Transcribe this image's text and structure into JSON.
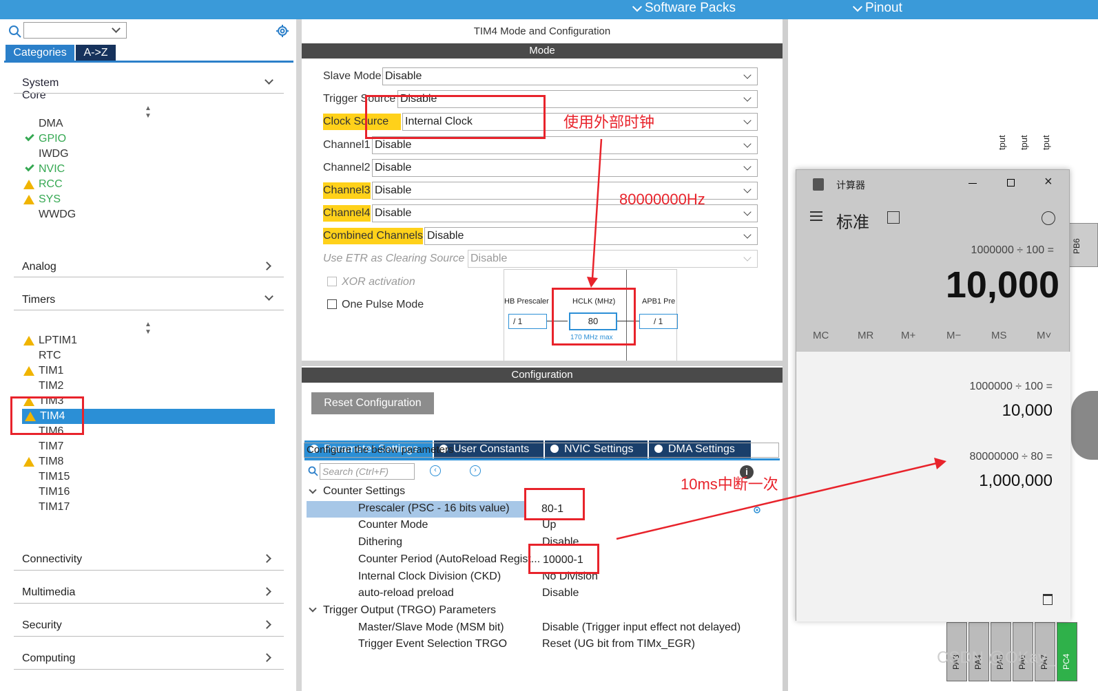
{
  "topbar": {
    "software_packs": "Software Packs",
    "pinout": "Pinout"
  },
  "left": {
    "tabs": {
      "categories": "Categories",
      "az": "A->Z"
    },
    "sections": {
      "system_core": "System Core",
      "analog": "Analog",
      "timers": "Timers",
      "connectivity": "Connectivity",
      "multimedia": "Multimedia",
      "security": "Security",
      "computing": "Computing"
    },
    "system_core_items": [
      "DMA",
      "GPIO",
      "IWDG",
      "NVIC",
      "RCC",
      "SYS",
      "WWDG"
    ],
    "timer_items": [
      "LPTIM1",
      "RTC",
      "TIM1",
      "TIM2",
      "TIM3",
      "TIM4",
      "TIM6",
      "TIM7",
      "TIM8",
      "TIM15",
      "TIM16",
      "TIM17"
    ]
  },
  "mid": {
    "title": "TIM4 Mode and Configuration",
    "mode_header": "Mode",
    "mode_fields": [
      {
        "label": "Slave Mode",
        "value": "Disable"
      },
      {
        "label": "Trigger Source",
        "value": "Disable"
      },
      {
        "label": "Clock Source",
        "value": "Internal Clock"
      },
      {
        "label": "Channel1",
        "value": "Disable"
      },
      {
        "label": "Channel2",
        "value": "Disable"
      },
      {
        "label": "Channel3",
        "value": "Disable"
      },
      {
        "label": "Channel4",
        "value": "Disable"
      },
      {
        "label": "Combined Channels",
        "value": "Disable"
      },
      {
        "label": "Use ETR as Clearing Source",
        "value": "Disable"
      }
    ],
    "xor_activation": "XOR activation",
    "one_pulse_mode": "One Pulse Mode",
    "config_header": "Configuration",
    "reset_config": "Reset Configuration",
    "tabs": [
      "Parameter Settings",
      "User Constants",
      "NVIC Settings",
      "DMA Settings"
    ],
    "configure_text": "Configure the below parameters :",
    "search_placeholder": "Search (Ctrl+F)",
    "counter_settings": "Counter Settings",
    "params": [
      {
        "name": "Prescaler (PSC - 16 bits value)",
        "value": "80-1"
      },
      {
        "name": "Counter Mode",
        "value": "Up"
      },
      {
        "name": "Dithering",
        "value": "Disable"
      },
      {
        "name": "Counter Period (AutoReload Regist...",
        "value": "10000-1"
      },
      {
        "name": "Internal Clock Division (CKD)",
        "value": "No Division"
      },
      {
        "name": "auto-reload preload",
        "value": "Disable"
      }
    ],
    "trgo_header": "Trigger Output (TRGO) Parameters",
    "trgo_params": [
      {
        "name": "Master/Slave Mode (MSM bit)",
        "value": "Disable (Trigger input effect not delayed)"
      },
      {
        "name": "Trigger Event Selection TRGO",
        "value": "Reset (UG bit from TIMx_EGR)"
      }
    ]
  },
  "clock_tree": {
    "hb_prescaler": "HB Prescaler",
    "hb_value": "/ 1",
    "hclk_label": "HCLK (MHz)",
    "hclk_value": "80",
    "hclk_max": "170 MHz max",
    "apb1_label": "APB1 Pre",
    "apb1_value": "/ 1"
  },
  "annotations": {
    "external_clock": "使用外部时钟",
    "freq": "80000000Hz",
    "interrupt": "10ms中断一次"
  },
  "calculator": {
    "title": "计算器",
    "mode": "标准",
    "expression": "1000000 ÷ 100 =",
    "display": "10,000",
    "memory_buttons": [
      "MC",
      "MR",
      "M+",
      "M−",
      "MS",
      "M˅"
    ],
    "history": [
      {
        "expr": "1000000  ÷  100 =",
        "result": "10,000"
      },
      {
        "expr": "80000000  ÷  80 =",
        "result": "1,000,000"
      }
    ]
  },
  "right_pins": {
    "top_labels": [
      "tput",
      "tput",
      "tput"
    ],
    "side_label": "PB6",
    "bottom_pins": [
      "PA3",
      "PA4",
      "PA5",
      "PA6",
      "PA7",
      "PC4"
    ]
  },
  "watermark": "CSDN @OKay_"
}
